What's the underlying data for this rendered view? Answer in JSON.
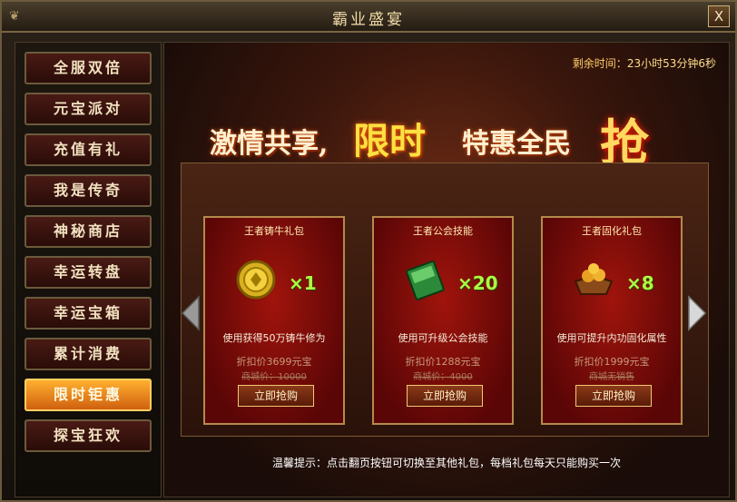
{
  "window": {
    "title": "霸业盛宴",
    "close_label": "X"
  },
  "sidebar": {
    "items": [
      {
        "label": "全服双倍"
      },
      {
        "label": "元宝派对"
      },
      {
        "label": "充值有礼"
      },
      {
        "label": "我是传奇"
      },
      {
        "label": "神秘商店"
      },
      {
        "label": "幸运转盘"
      },
      {
        "label": "幸运宝箱"
      },
      {
        "label": "累计消费"
      },
      {
        "label": "限时钜惠"
      },
      {
        "label": "探宝狂欢"
      }
    ],
    "active_index": 8
  },
  "timer": {
    "label": "剩余时间：",
    "value": "23小时53分钟6秒"
  },
  "banner": {
    "part1": "激情共享,",
    "part2": "限时",
    "part3": "特惠全民",
    "part4": "抢"
  },
  "cards": [
    {
      "title": "王者铸牛礼包",
      "item_icon": "gold-coin-icon",
      "quantity": "×1",
      "desc": "使用获得50万铸牛修为",
      "price": "折扣价3699元宝",
      "original": "商城价：10000",
      "button": "立即抢购"
    },
    {
      "title": "王者公会技能",
      "item_icon": "skill-book-icon",
      "quantity": "×20",
      "desc": "使用可升级公会技能",
      "price": "折扣价1288元宝",
      "original": "商城价：4000",
      "button": "立即抢购"
    },
    {
      "title": "王者固化礼包",
      "item_icon": "treasure-box-icon",
      "quantity": "×8",
      "desc": "使用可提升内功固化属性",
      "price": "折扣价1999元宝",
      "original": "商城无销售",
      "button": "立即抢购"
    }
  ],
  "tip": "温馨提示：点击翻页按钮可切换至其他礼包，每档礼包每天只能购买一次",
  "colors": {
    "accent": "#ffb030",
    "card_red": "#a0140c",
    "quantity_green": "#aaff44"
  }
}
